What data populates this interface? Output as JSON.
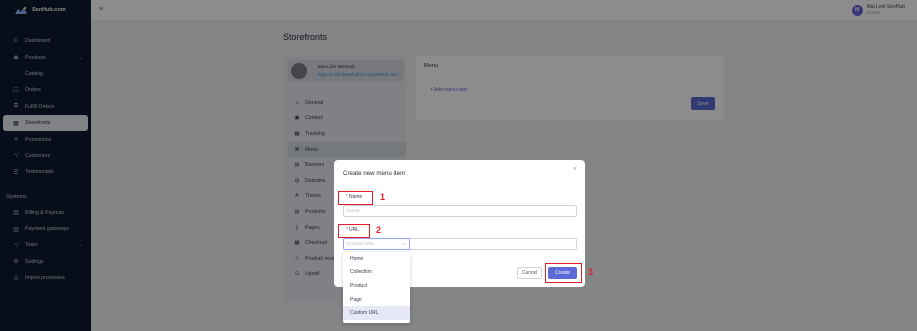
{
  "app": {
    "logo_text": "SenHub.com",
    "hamburger": "≡"
  },
  "user": {
    "initial": "M",
    "name": "Mai Linh SenHub",
    "role": "Owner"
  },
  "sidebar": {
    "items": [
      {
        "icon": "ıl.",
        "label": "Dashboard"
      },
      {
        "icon": "◉",
        "label": "Products",
        "chevron": "⌄"
      },
      {
        "icon": "◌",
        "label": "Catalog"
      },
      {
        "icon": "☐",
        "label": "Orders"
      },
      {
        "icon": "⧉",
        "label": "Fulfill Orders"
      },
      {
        "icon": "▦",
        "label": "Storefronts"
      },
      {
        "icon": "✕",
        "label": "Promotions"
      },
      {
        "icon": "⁺⁄",
        "label": "Customers"
      },
      {
        "icon": "☰",
        "label": "Testimonials"
      }
    ],
    "section_label": "Systems",
    "system_items": [
      {
        "icon": "▥",
        "label": "Billing & Payouts"
      },
      {
        "icon": "▥",
        "label": "Payment gateways"
      },
      {
        "icon": "⁺⁄",
        "label": "Team",
        "chevron": "⌄"
      },
      {
        "icon": "⚙",
        "label": "Settings"
      },
      {
        "icon": "⊙",
        "label": "Import processes"
      }
    ]
  },
  "page": {
    "title": "Storefronts"
  },
  "store": {
    "name": "Mai Linh SenHub",
    "url": "https://mailinhsenhub123.mysenhub.com",
    "menu": [
      {
        "icon": "⌂",
        "label": "General"
      },
      {
        "icon": "▣",
        "label": "Contact"
      },
      {
        "icon": "▦",
        "label": "Tracking"
      },
      {
        "icon": "⌘",
        "label": "Menu"
      },
      {
        "icon": "▤",
        "label": "Banners"
      },
      {
        "icon": "◍",
        "label": "Domains"
      },
      {
        "icon": "A",
        "label": "Theme"
      },
      {
        "icon": "▤",
        "label": "Products"
      },
      {
        "icon": "▯",
        "label": "Pages"
      },
      {
        "icon": "▦",
        "label": "Checkout"
      },
      {
        "icon": "☆",
        "label": "Product review"
      },
      {
        "icon": "⊙",
        "label": "Upsell"
      }
    ]
  },
  "menu_panel": {
    "title": "Menu",
    "add_label": "+ Add menu item",
    "save_label": "Save"
  },
  "modal": {
    "title": "Create new menu item",
    "close": "×",
    "name_label": "Name",
    "name_placeholder": "Name",
    "url_label": "URL",
    "url_select_value": "Custom URL",
    "cancel_label": "Cancel",
    "create_label": "Create",
    "required_mark": "*"
  },
  "dropdown": {
    "options": [
      "Home",
      "Collection",
      "Product",
      "Page",
      "Custom URL"
    ],
    "selected": "Custom URL"
  },
  "annotations": {
    "one": "1",
    "two": "2",
    "three": "3",
    "color": "#e11d2a"
  },
  "colors": {
    "sidebar_bg": "#0f1a2e",
    "primary": "#5b6ad6",
    "avatar": "#6b63d9",
    "link": "#2a8fd6"
  }
}
